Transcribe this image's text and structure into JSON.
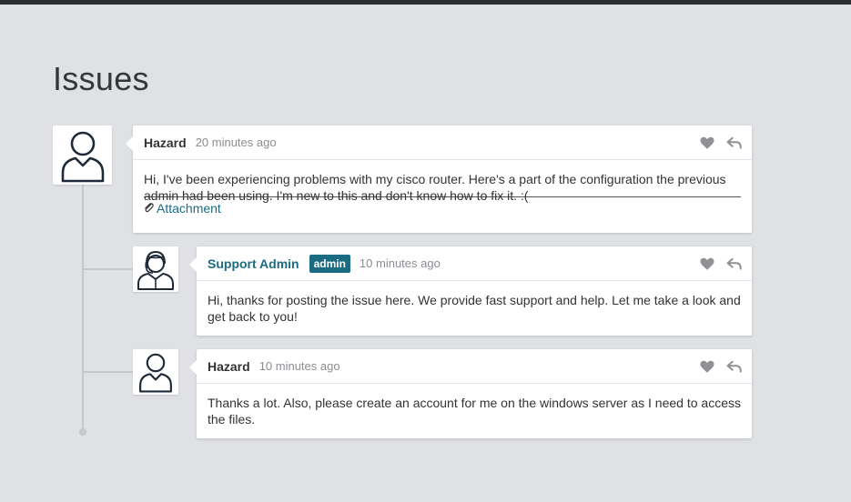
{
  "page": {
    "title": "Issues"
  },
  "comments": [
    {
      "author": "Hazard",
      "time": "20 minutes ago",
      "text": "Hi, I've been experiencing problems with my cisco router. Here's a part of the configuration the previous admin had been using. I'm new to this and don't know how to fix it. :(",
      "attachment_label": "Attachment",
      "avatar_icon": "user-icon"
    },
    {
      "author": "Support Admin",
      "badge": "admin",
      "time": "10 minutes ago",
      "text": "Hi, thanks for posting the issue here. We provide fast support and help. Let me take a look and get back to you!",
      "avatar_icon": "support-agent-icon"
    },
    {
      "author": "Hazard",
      "time": "10 minutes ago",
      "text": "Thanks a lot. Also, please create an account for me on the windows server as I need to access the files.",
      "avatar_icon": "user-icon"
    }
  ],
  "icons": {
    "like": "heart-icon",
    "reply": "reply-icon",
    "attachment": "paperclip-icon"
  },
  "colors": {
    "accent": "#1b6b83",
    "background": "#dfe1e4",
    "timeline": "#c6c8cb",
    "muted": "#8a8d91",
    "icon": "#8f9194"
  }
}
